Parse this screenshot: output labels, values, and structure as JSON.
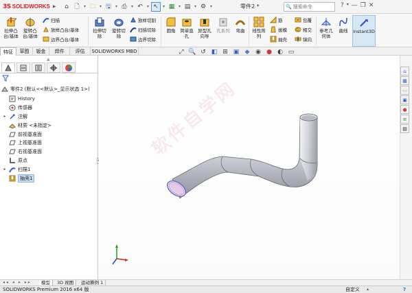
{
  "app": {
    "logo_ds": "3S",
    "logo_text": "SOLIDWORKS",
    "document_title": "零件2 *",
    "search_placeholder": "搜索命令"
  },
  "ribbon": {
    "features": [
      {
        "id": "extruded-boss",
        "label": "拉伸凸\n台/基体"
      },
      {
        "id": "revolved-boss",
        "label": "旋转凸\n台/基体"
      },
      {
        "id": "swept-boss",
        "label": "扫描"
      },
      {
        "id": "lofted-boss",
        "label": "放样凸台/基体"
      },
      {
        "id": "boundary-boss",
        "label": "边界凸台/基体"
      },
      {
        "id": "extruded-cut",
        "label": "拉伸切\n除"
      },
      {
        "id": "revolved-cut",
        "label": "旋转切\n除"
      },
      {
        "id": "lofted-cut",
        "label": "放样切割"
      },
      {
        "id": "swept-cut",
        "label": "扫描切除"
      },
      {
        "id": "boundary-cut",
        "label": "边界切除"
      },
      {
        "id": "fillet",
        "label": "圆角"
      },
      {
        "id": "simple-hole",
        "label": "简单直\n孔"
      },
      {
        "id": "hole-wizard",
        "label": "异型孔\n向导"
      },
      {
        "id": "hole-series",
        "label": "孔系列"
      },
      {
        "id": "wrap",
        "label": "弯曲"
      },
      {
        "id": "linear-pattern",
        "label": "线性阵\n列"
      },
      {
        "id": "rib",
        "label": "筋"
      },
      {
        "id": "draft",
        "label": "拔模"
      },
      {
        "id": "shell",
        "label": "抽壳"
      },
      {
        "id": "wrap2",
        "label": "包覆"
      },
      {
        "id": "intersect",
        "label": "相交"
      },
      {
        "id": "mirror",
        "label": "镜向"
      },
      {
        "id": "reference-geometry",
        "label": "参考几\n何体"
      },
      {
        "id": "curves",
        "label": "曲线"
      },
      {
        "id": "instant3d",
        "label": "Instant3D"
      }
    ]
  },
  "tabs": [
    "特征",
    "草图",
    "钣金",
    "焊件",
    "评估",
    "SOLIDWORKS MBD"
  ],
  "feature_tree": {
    "root": "零件2 (默认<<默认>_显示状态 1>)",
    "items": [
      {
        "label": "History",
        "expandable": false
      },
      {
        "label": "传感器",
        "expandable": false
      },
      {
        "label": "注解",
        "expandable": true
      },
      {
        "label": "材质 <未指定>",
        "expandable": false
      },
      {
        "label": "前视基准面",
        "expandable": false
      },
      {
        "label": "上视基准面",
        "expandable": false
      },
      {
        "label": "右视基准面",
        "expandable": false
      },
      {
        "label": "原点",
        "expandable": false
      },
      {
        "label": "扫描1",
        "expandable": true
      },
      {
        "label": "抽壳1",
        "expandable": false,
        "selected": true
      }
    ]
  },
  "bottom_tabs": [
    "模型",
    "3D 视图",
    "运动算例 1"
  ],
  "status": {
    "left": "SOLIDWORKS Premium 2016 x64 版",
    "units": "自定义",
    "help": "?"
  },
  "watermark": "软件自学网",
  "colors": {
    "accent": "#1a6fc0",
    "logo_red": "#d4202c",
    "selection": "#c7ddf2",
    "pipe": "#c9cdd6",
    "pipe_inner": "#e6c9e6"
  }
}
